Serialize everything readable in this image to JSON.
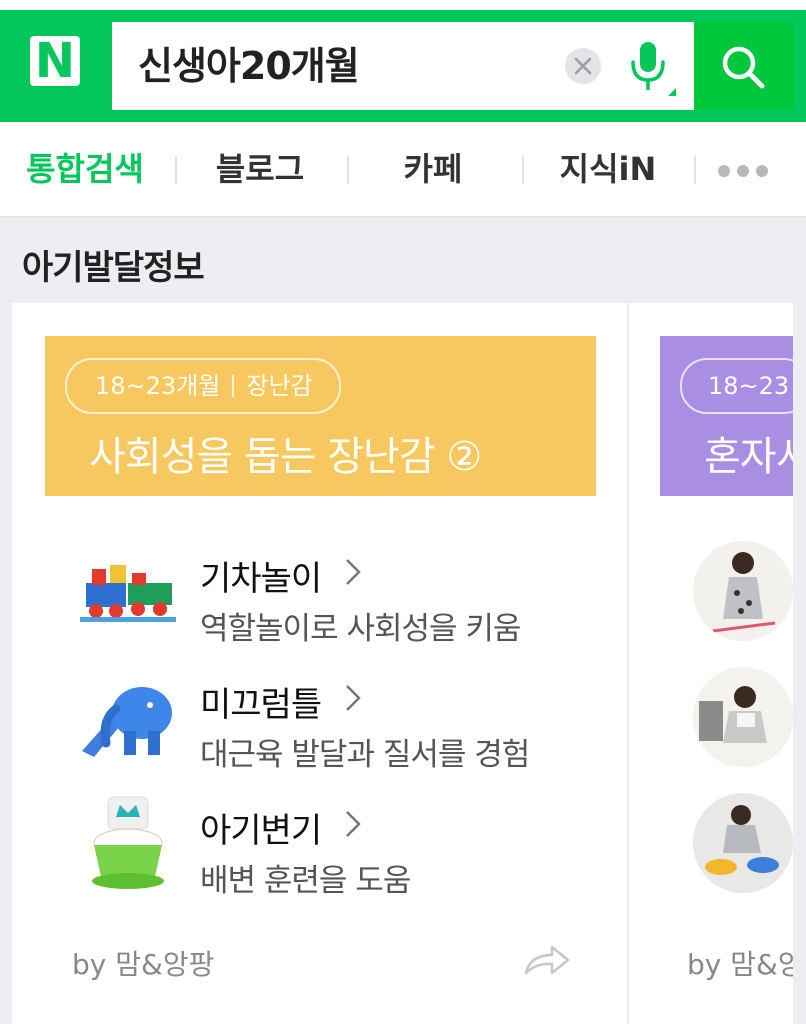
{
  "header": {
    "logo": "N",
    "search_query": "신생아20개월"
  },
  "tabs": [
    "통합검색",
    "블로그",
    "카페",
    "지식iN"
  ],
  "section_title": "아기발달정보",
  "cards": [
    {
      "age": "18~23개월",
      "category": "장난감",
      "title": "사회성을 돕는 장난감 ②",
      "banner_color": "#f6c85f",
      "items": [
        {
          "title": "기차놀이",
          "desc": "역할놀이로 사회성을 키움"
        },
        {
          "title": "미끄럼틀",
          "desc": "대근육 발달과 질서를 경험"
        },
        {
          "title": "아기변기",
          "desc": "배변 훈련을 도움"
        }
      ],
      "source": "by 맘&앙팡"
    },
    {
      "age": "18~23",
      "title": "혼자서",
      "banner_color": "#a98ee3",
      "source": "by 맘&앙"
    }
  ],
  "icons": [
    "search-icon",
    "mic-icon",
    "clear-icon",
    "chevron-right-icon",
    "share-icon",
    "more-icon"
  ]
}
